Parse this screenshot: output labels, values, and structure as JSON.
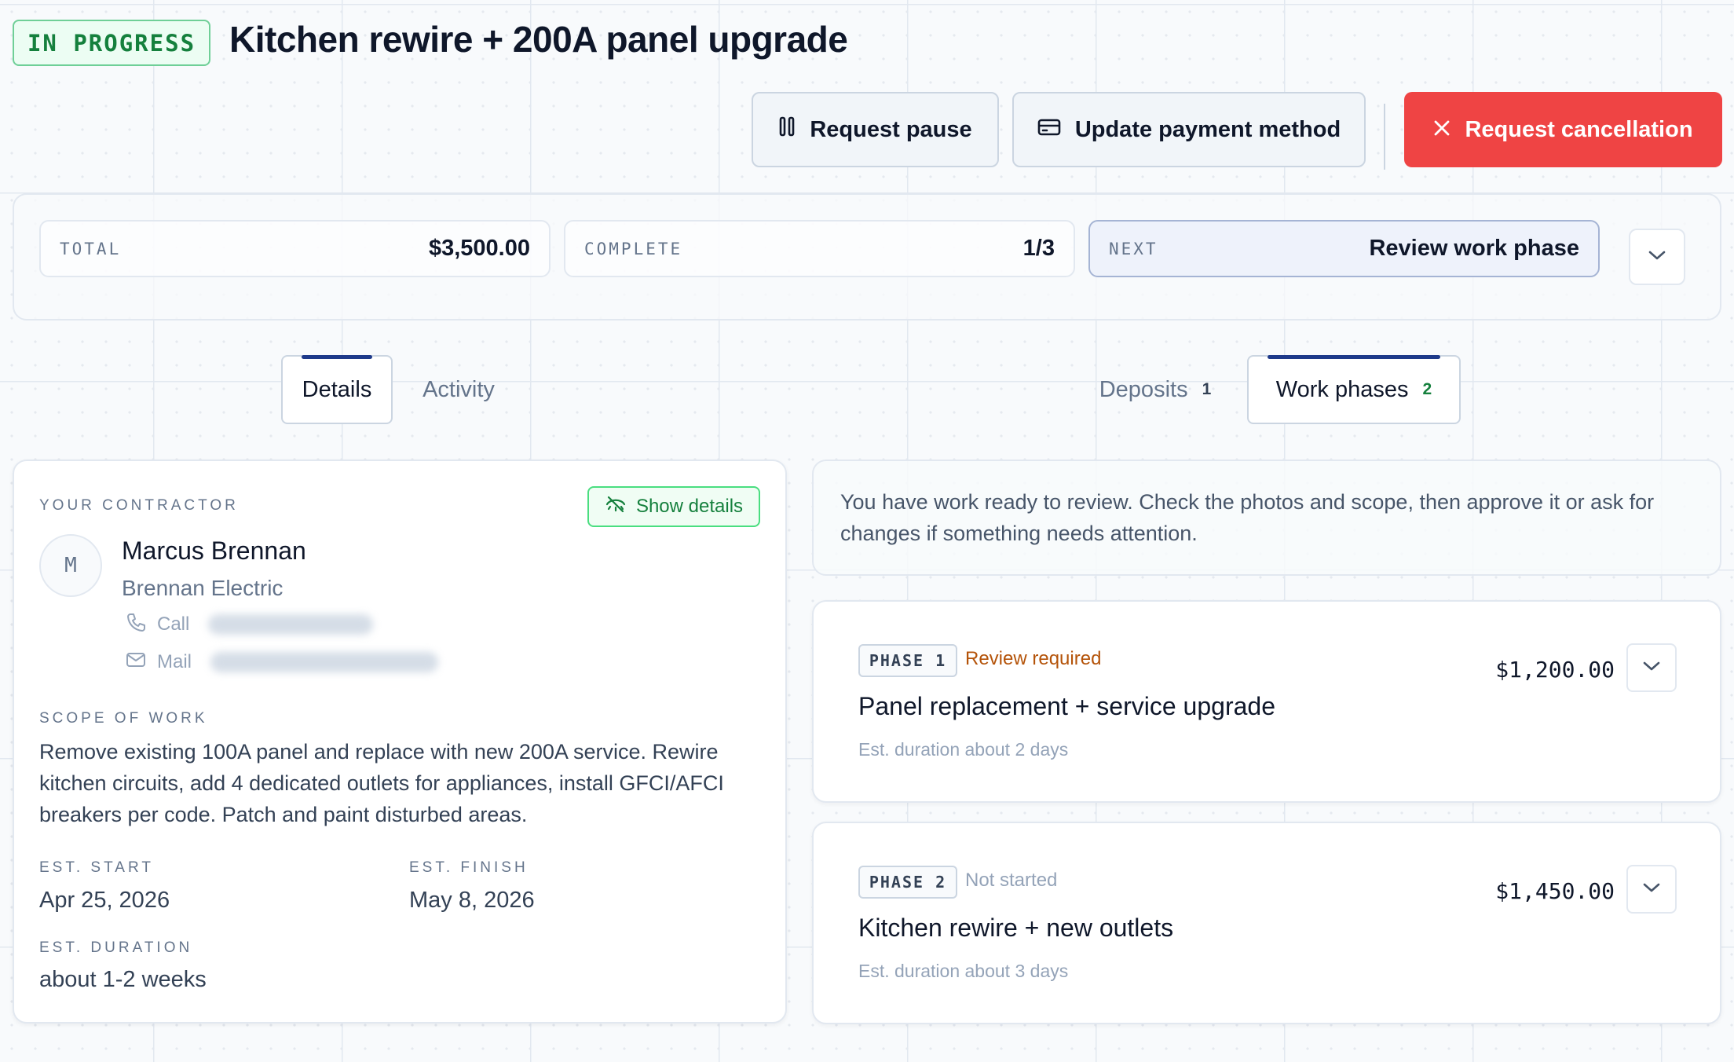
{
  "header": {
    "status": "IN PROGRESS",
    "title": "Kitchen rewire + 200A panel upgrade"
  },
  "actions": {
    "pause_label": "Request pause",
    "payment_label": "Update payment method",
    "cancel_label": "Request cancellation"
  },
  "summary": {
    "total_label": "TOTAL",
    "total_value": "$3,500.00",
    "complete_label": "COMPLETE",
    "complete_value": "1/3",
    "next_label": "NEXT",
    "next_value": "Review work phase"
  },
  "tabs_left": [
    {
      "label": "Details",
      "active": true
    },
    {
      "label": "Activity",
      "active": false
    }
  ],
  "tabs_right": [
    {
      "label": "Deposits",
      "count": "1",
      "active": false
    },
    {
      "label": "Work phases",
      "count": "2",
      "active": true
    }
  ],
  "contractor": {
    "section_label": "YOUR CONTRACTOR",
    "show_details_label": "Show details",
    "avatar_initial": "M",
    "name": "Marcus Brennan",
    "company": "Brennan Electric",
    "call_label": "Call",
    "mail_label": "Mail"
  },
  "scope": {
    "label": "SCOPE OF WORK",
    "text": "Remove existing 100A panel and replace with new 200A service. Rewire kitchen circuits, add 4 dedicated outlets for appliances, install GFCI/AFCI breakers per code. Patch and paint disturbed areas."
  },
  "schedule": {
    "start_label": "EST. START",
    "start_value": "Apr 25, 2026",
    "finish_label": "EST. FINISH",
    "finish_value": "May 8, 2026",
    "duration_label": "EST. DURATION",
    "duration_value": "about 1-2 weeks"
  },
  "notice": "You have work ready to review. Check the photos and scope, then approve it or ask for changes if something needs attention.",
  "phases": [
    {
      "badge": "PHASE 1",
      "status": "Review required",
      "title": "Panel replacement + service upgrade",
      "duration": "Est. duration about 2 days",
      "price": "$1,200.00"
    },
    {
      "badge": "PHASE 2",
      "status": "Not started",
      "title": "Kitchen rewire + new outlets",
      "duration": "Est. duration about 3 days",
      "price": "$1,450.00"
    }
  ],
  "colors": {
    "accent_navy": "#1e3a8a",
    "success_green": "#15803d",
    "danger_red": "#ef4444",
    "warning_amber": "#b45309"
  },
  "icons": {
    "pause": "pause-icon",
    "payment": "credit-card-icon",
    "cancel": "close-icon",
    "expand": "chevron-down-icon",
    "show_details": "eye-off-icon",
    "call": "phone-icon",
    "mail": "mail-icon"
  }
}
